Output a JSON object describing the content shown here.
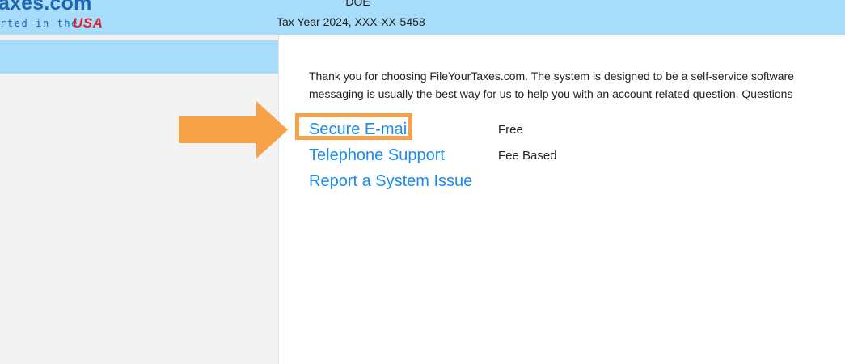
{
  "header": {
    "logo_text": "FileYourTaxes.com",
    "logo_visible_text": "axes.com",
    "logo_tagline": "rted in the",
    "logo_country": "USA",
    "user_name": "DOE",
    "tax_year_line": "Tax Year 2024, XXX-XX-5458"
  },
  "main": {
    "intro_line1": "Thank you for choosing FileYourTaxes.com. The system is designed to be a self-service software",
    "intro_line2": "messaging is usually the best way for us to help you with an account related question. Questions",
    "options": [
      {
        "label": "Secure E-mail",
        "price": "Free"
      },
      {
        "label": "Telephone Support",
        "price": "Fee Based"
      },
      {
        "label": "Report a System Issue",
        "price": ""
      }
    ]
  },
  "colors": {
    "header_bg": "#a7dcfa",
    "link": "#1a8cf0",
    "logo_blue": "#1f64b0",
    "logo_red": "#d8262e",
    "highlight": "#f7a149",
    "sidebar_bg": "#f3f3f3"
  }
}
